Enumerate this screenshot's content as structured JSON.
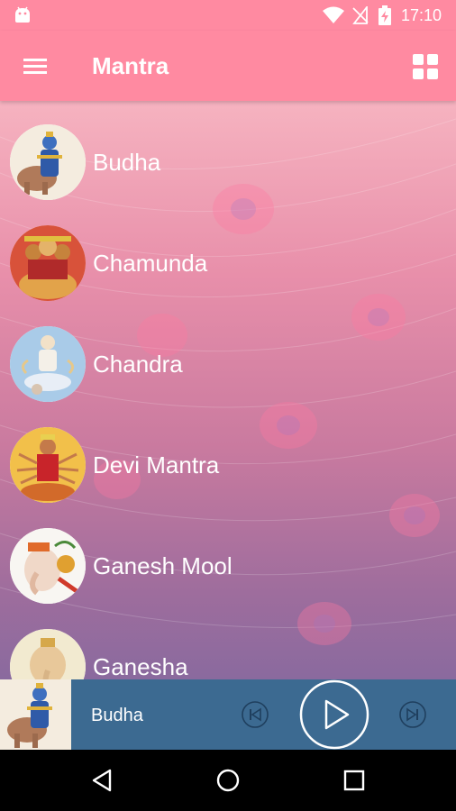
{
  "status_bar": {
    "time": "17:10",
    "icons": [
      "android-icon",
      "wifi-icon",
      "no-sim-icon",
      "battery-charging-icon"
    ]
  },
  "app_bar": {
    "title": "Mantra",
    "menu_icon": "hamburger-menu-icon",
    "grid_icon": "grid-view-icon"
  },
  "mantras": [
    {
      "label": "Budha",
      "image": "budha-deity-image"
    },
    {
      "label": "Chamunda",
      "image": "chamunda-deity-image"
    },
    {
      "label": "Chandra",
      "image": "chandra-deity-image"
    },
    {
      "label": "Devi Mantra",
      "image": "devi-deity-image"
    },
    {
      "label": "Ganesh Mool",
      "image": "ganesh-mool-deity-image"
    },
    {
      "label": "Ganesha",
      "image": "ganesha-deity-image"
    }
  ],
  "player": {
    "track_title": "Budha",
    "prev_icon": "skip-previous-icon",
    "play_icon": "play-icon",
    "next_icon": "skip-next-icon"
  },
  "colors": {
    "app_bar": "#ff8aa1",
    "player_bar": "#3c6a91",
    "text": "#ffffff"
  }
}
